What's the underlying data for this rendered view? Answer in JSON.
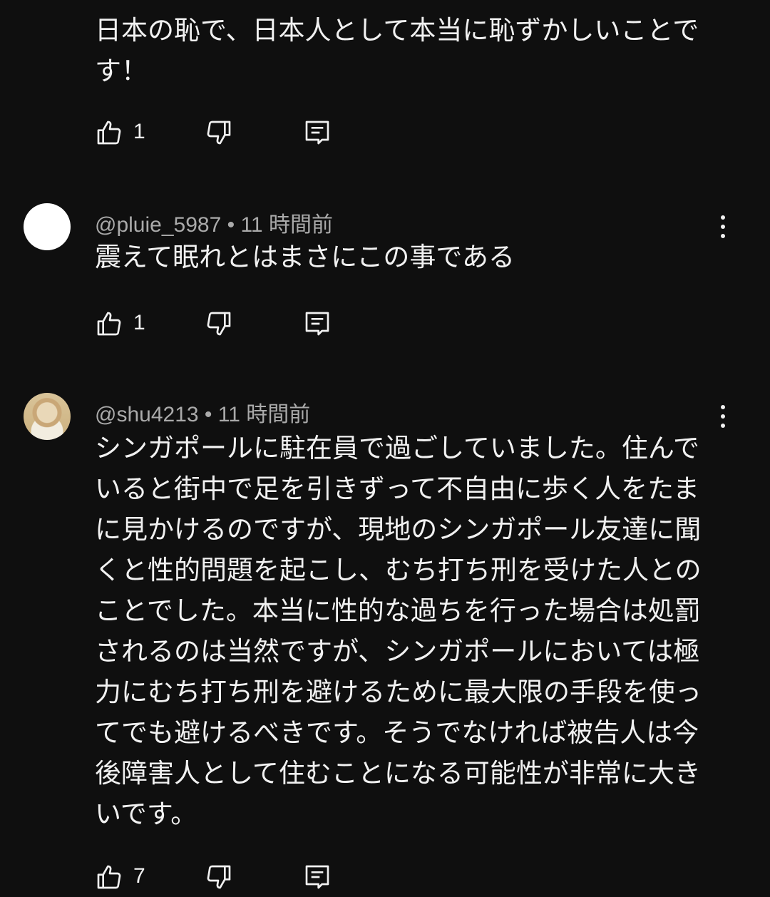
{
  "comments": [
    {
      "text": "日本の恥で、日本人として本当に恥ずかしいことです！",
      "likes": "1"
    },
    {
      "author": "@pluie_5987",
      "time": "11 時間前",
      "separator": "•",
      "text": "震えて眠れとはまさにこの事である",
      "likes": "1",
      "avatar": "white-circle"
    },
    {
      "author": "@shu4213",
      "time": "11 時間前",
      "separator": "•",
      "text": "シンガポールに駐在員で過ごしていました。住んでいると街中で足を引きずって不自由に歩く人をたまに見かけるのですが、現地のシンガポール友達に聞くと性的問題を起こし、むち打ち刑を受けた人とのことでした。本当に性的な過ちを行った場合は処罰されるのは当然ですが、シンガポールにおいては極力にむち打ち刑を避けるために最大限の手段を使ってでも避けるべきです。そうでなければ被告人は今後障害人として住むことになる可能性が非常に大きいです。",
      "likes": "7",
      "avatar": "portrait-photo"
    }
  ],
  "icons": {
    "like": "thumbs-up-icon",
    "dislike": "thumbs-down-icon",
    "reply": "reply-comment-icon",
    "menu": "more-vert-icon"
  }
}
